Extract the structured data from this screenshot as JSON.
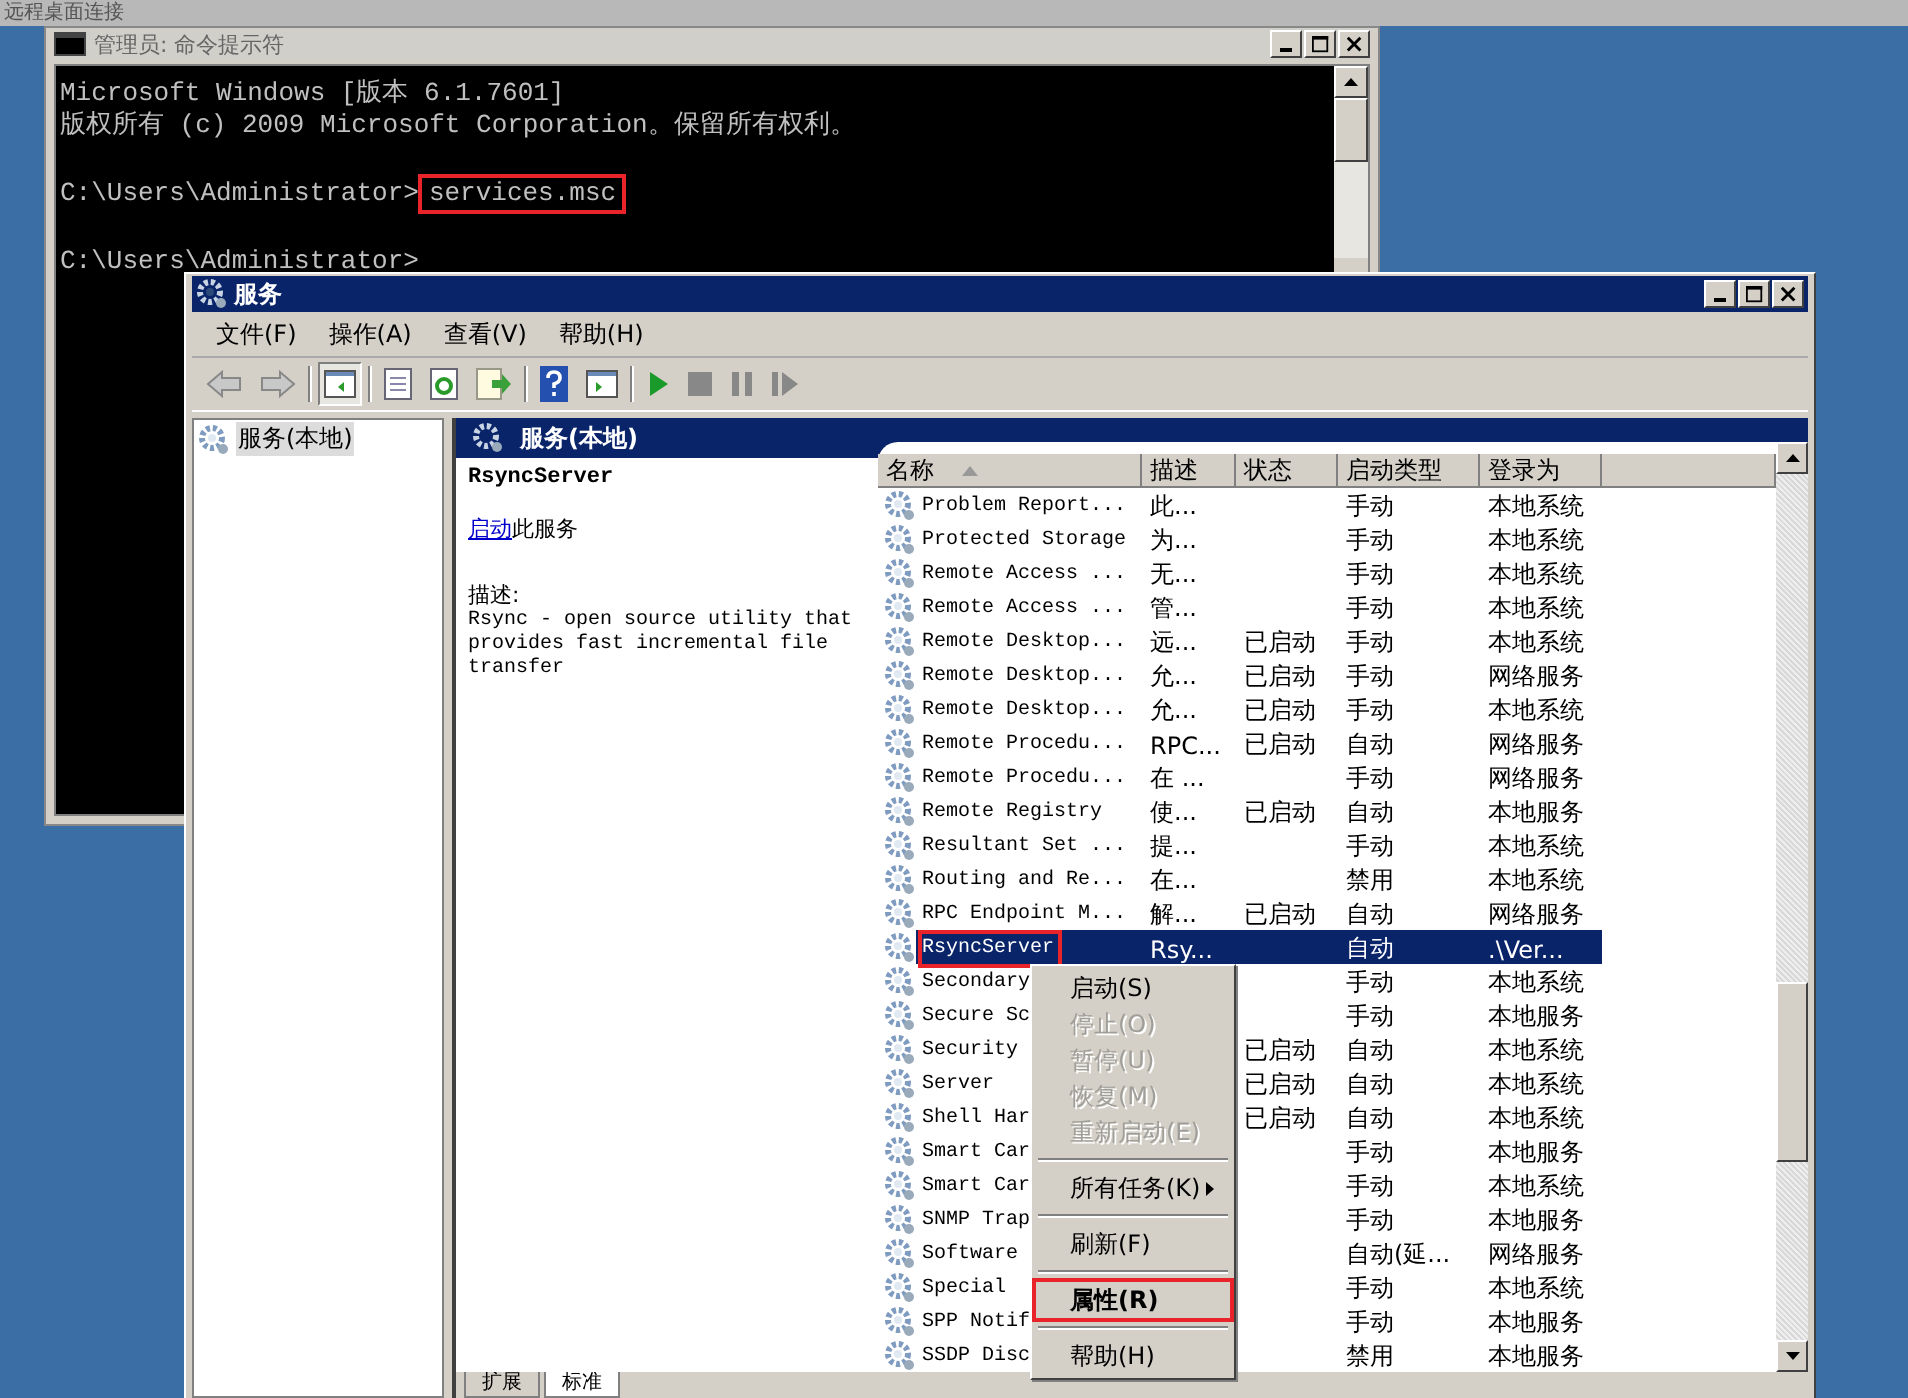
{
  "remote_bar": {
    "title": "远程桌面连接"
  },
  "console": {
    "title": "管理员: 命令提示符",
    "banner": [
      "Microsoft Windows [版本 6.1.7601]",
      "版权所有 (c) 2009 Microsoft Corporation。保留所有权利。"
    ],
    "prompts": [
      {
        "prompt": "C:\\Users\\Administrator>",
        "command": "services.msc",
        "highlight": true
      },
      {
        "prompt": "C:\\Users\\Administrator>"
      }
    ]
  },
  "services": {
    "title": "服务",
    "menu": [
      "文件(F)",
      "操作(A)",
      "查看(V)",
      "帮助(H)"
    ],
    "tree": [
      {
        "label": "服务(本地)",
        "selected": true
      }
    ],
    "pane_title": "服务(本地)",
    "detail": {
      "name": "RsyncServer",
      "start_link": "启动",
      "start_rest": "此服务",
      "desc_label": "描述:",
      "description": "Rsync - open source utility that provides fast incremental file transfer"
    },
    "columns": [
      "名称",
      "描述",
      "状态",
      "启动类型",
      "登录为"
    ],
    "rows": [
      {
        "name": "Problem Report...",
        "desc": "此...",
        "status": "",
        "startup": "手动",
        "logon": "本地系统",
        "selected": false,
        "highlight": false
      },
      {
        "name": "Protected Storage",
        "desc": "为...",
        "status": "",
        "startup": "手动",
        "logon": "本地系统",
        "selected": false,
        "highlight": false
      },
      {
        "name": "Remote Access ...",
        "desc": "无...",
        "status": "",
        "startup": "手动",
        "logon": "本地系统",
        "selected": false,
        "highlight": false
      },
      {
        "name": "Remote Access ...",
        "desc": "管...",
        "status": "",
        "startup": "手动",
        "logon": "本地系统",
        "selected": false,
        "highlight": false
      },
      {
        "name": "Remote Desktop...",
        "desc": "远...",
        "status": "已启动",
        "startup": "手动",
        "logon": "本地系统",
        "selected": false,
        "highlight": false
      },
      {
        "name": "Remote Desktop...",
        "desc": "允...",
        "status": "已启动",
        "startup": "手动",
        "logon": "网络服务",
        "selected": false,
        "highlight": false
      },
      {
        "name": "Remote Desktop...",
        "desc": "允...",
        "status": "已启动",
        "startup": "手动",
        "logon": "本地系统",
        "selected": false,
        "highlight": false
      },
      {
        "name": "Remote Procedu...",
        "desc": "RPC...",
        "status": "已启动",
        "startup": "自动",
        "logon": "网络服务",
        "selected": false,
        "highlight": false
      },
      {
        "name": "Remote Procedu...",
        "desc": "在 ...",
        "status": "",
        "startup": "手动",
        "logon": "网络服务",
        "selected": false,
        "highlight": false
      },
      {
        "name": "Remote Registry",
        "desc": "使...",
        "status": "已启动",
        "startup": "自动",
        "logon": "本地服务",
        "selected": false,
        "highlight": false
      },
      {
        "name": "Resultant Set ...",
        "desc": "提...",
        "status": "",
        "startup": "手动",
        "logon": "本地系统",
        "selected": false,
        "highlight": false
      },
      {
        "name": "Routing and Re...",
        "desc": "在...",
        "status": "",
        "startup": "禁用",
        "logon": "本地系统",
        "selected": false,
        "highlight": false
      },
      {
        "name": "RPC Endpoint M...",
        "desc": "解...",
        "status": "已启动",
        "startup": "自动",
        "logon": "网络服务",
        "selected": false,
        "highlight": false
      },
      {
        "name": "RsyncServer",
        "desc": "Rsy...",
        "status": "",
        "startup": "自动",
        "logon": ".\\Ver...",
        "selected": true,
        "highlight": true
      },
      {
        "name": "Secondary",
        "desc": "",
        "status": "",
        "startup": "手动",
        "logon": "本地系统",
        "selected": false,
        "highlight": false
      },
      {
        "name": "Secure Sc",
        "desc": "",
        "status": "",
        "startup": "手动",
        "logon": "本地服务",
        "selected": false,
        "highlight": false
      },
      {
        "name": "Security",
        "desc": "",
        "status": "已启动",
        "startup": "自动",
        "logon": "本地系统",
        "selected": false,
        "highlight": false
      },
      {
        "name": "Server",
        "desc": "",
        "status": "已启动",
        "startup": "自动",
        "logon": "本地系统",
        "selected": false,
        "highlight": false
      },
      {
        "name": "Shell Har",
        "desc": "",
        "status": "已启动",
        "startup": "自动",
        "logon": "本地系统",
        "selected": false,
        "highlight": false
      },
      {
        "name": "Smart Car",
        "desc": "",
        "status": "",
        "startup": "手动",
        "logon": "本地服务",
        "selected": false,
        "highlight": false
      },
      {
        "name": "Smart Car",
        "desc": "",
        "status": "",
        "startup": "手动",
        "logon": "本地系统",
        "selected": false,
        "highlight": false
      },
      {
        "name": "SNMP Trap",
        "desc": "",
        "status": "",
        "startup": "手动",
        "logon": "本地服务",
        "selected": false,
        "highlight": false
      },
      {
        "name": "Software",
        "desc": "",
        "status": "",
        "startup": "自动(延...",
        "logon": "网络服务",
        "selected": false,
        "highlight": false
      },
      {
        "name": "Special",
        "desc": "",
        "status": "",
        "startup": "手动",
        "logon": "本地系统",
        "selected": false,
        "highlight": false
      },
      {
        "name": "SPP Notif",
        "desc": "",
        "status": "",
        "startup": "手动",
        "logon": "本地服务",
        "selected": false,
        "highlight": false
      },
      {
        "name": "SSDP Disc",
        "desc": "",
        "status": "",
        "startup": "禁用",
        "logon": "本地服务",
        "selected": false,
        "highlight": false
      }
    ],
    "context_menu": [
      {
        "kind": "item",
        "label": "启动(S)",
        "disabled": false,
        "bold": false,
        "submenu": false,
        "highlight": false
      },
      {
        "kind": "item",
        "label": "停止(O)",
        "disabled": true,
        "bold": false,
        "submenu": false,
        "highlight": false
      },
      {
        "kind": "item",
        "label": "暂停(U)",
        "disabled": true,
        "bold": false,
        "submenu": false,
        "highlight": false
      },
      {
        "kind": "item",
        "label": "恢复(M)",
        "disabled": true,
        "bold": false,
        "submenu": false,
        "highlight": false
      },
      {
        "kind": "item",
        "label": "重新启动(E)",
        "disabled": true,
        "bold": false,
        "submenu": false,
        "highlight": false
      },
      {
        "kind": "separator"
      },
      {
        "kind": "item",
        "label": "所有任务(K)",
        "disabled": false,
        "bold": false,
        "submenu": true,
        "highlight": false
      },
      {
        "kind": "separator"
      },
      {
        "kind": "item",
        "label": "刷新(F)",
        "disabled": false,
        "bold": false,
        "submenu": false,
        "highlight": false
      },
      {
        "kind": "separator"
      },
      {
        "kind": "item",
        "label": "属性(R)",
        "disabled": false,
        "bold": true,
        "submenu": false,
        "highlight": true
      },
      {
        "kind": "separator"
      },
      {
        "kind": "item",
        "label": "帮助(H)",
        "disabled": false,
        "bold": false,
        "submenu": false,
        "highlight": false
      }
    ],
    "bottom_tabs": [
      {
        "label": "扩展",
        "selected": false
      },
      {
        "label": "标准",
        "selected": true
      }
    ]
  }
}
